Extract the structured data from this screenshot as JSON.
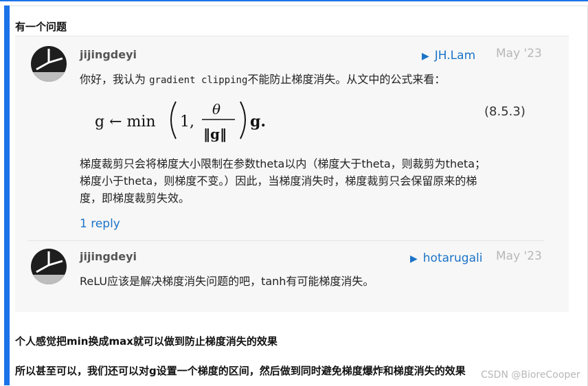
{
  "heading": "有一个问题",
  "post1": {
    "username": "jijingdeyi",
    "reply_to": "JH.Lam",
    "date": "May '23",
    "intro_text": "你好，我认为 ",
    "intro_code": "gradient clipping",
    "intro_text2": "不能防止梯度消失。从文中的公式来看：",
    "formula": {
      "lhs": "g ← min",
      "one": "1,",
      "numerator": "θ",
      "denominator": "‖g‖",
      "rhs": "g."
    },
    "equation_number": "(8.5.3)",
    "para_line1": "梯度裁剪只会将梯度大小限制在参数theta以内（梯度大于theta，则裁剪为theta；",
    "para_line2": "梯度小于theta，则梯度不变。）因此，当梯度消失时，梯度裁剪只会保留原来的梯",
    "para_line3": "度，即梯度裁剪失效。",
    "replies_link": "1 reply"
  },
  "post2": {
    "username": "jijingdeyi",
    "reply_to": "hotarugali",
    "date": "May '23",
    "text": "ReLU应该是解决梯度消失问题的吧，tanh有可能梯度消失。"
  },
  "paragraph1": "个人感觉把min换成max就可以做到防止梯度消失的效果",
  "paragraph2": "所以甚至可以，我们还可以对g设置一个梯度的区间，然后做到同时避免梯度爆炸和梯度消失的效果",
  "watermark": "CSDN @BioreCooper",
  "icons": {
    "reply_arrow": "reply-arrow-icon",
    "avatar": "avatar-icon"
  },
  "colors": {
    "accent": "#1a73e8",
    "link": "#1a73c7",
    "quote_bg": "#f7f7f7"
  }
}
